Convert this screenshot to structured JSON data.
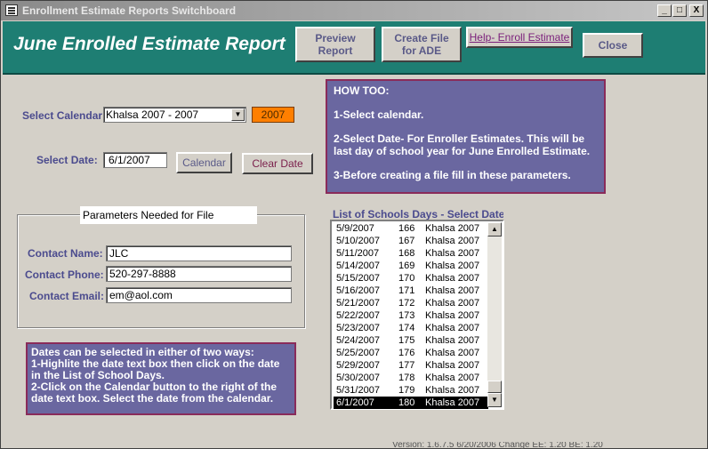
{
  "window": {
    "title": "Enrollment Estimate Reports Switchboard",
    "minimize": "_",
    "maximize": "□",
    "close": "X"
  },
  "header": {
    "title": "June Enrolled Estimate Report",
    "buttons": {
      "preview": "Preview Report",
      "create_file": "Create File for ADE",
      "help": "Help- Enroll Estimate",
      "close": "Close"
    }
  },
  "form": {
    "calendar_label": "Select Calendar:",
    "calendar_value": "Khalsa 2007 - 2007",
    "year_value": "2007",
    "date_label": "Select Date:",
    "date_value": "6/1/2007",
    "calendar_button": "Calendar",
    "clear_date_button": "Clear Date"
  },
  "howto": {
    "heading": "HOW TOO:",
    "step1": "1-Select calendar.",
    "step2": "2-Select Date- For  Enroller  Estimates.  This will be last day of school year for June Enrolled Estimate.",
    "step3": "3-Before creating a file fill in these parameters."
  },
  "parameters": {
    "caption": "Parameters Needed for File",
    "contact_name_label": "Contact Name:",
    "contact_name_value": "JLC",
    "contact_phone_label": "Contact Phone:",
    "contact_phone_value": "520-297-8888",
    "contact_email_label": "Contact Email:",
    "contact_email_value": "em@aol.com"
  },
  "dates_note": {
    "line1": "Dates can be selected in either of two ways:",
    "line2": "1-Highlite the date text box then click on the date in the List of School Days.",
    "line3": "2-Click on the Calendar button to the right of the date text box. Select the date from the calendar."
  },
  "school_days": {
    "caption": "List of Schools Days - Select Date",
    "rows": [
      {
        "date": "5/9/2007",
        "day": "166",
        "calendar": "Khalsa 2007",
        "selected": false
      },
      {
        "date": "5/10/2007",
        "day": "167",
        "calendar": "Khalsa 2007",
        "selected": false
      },
      {
        "date": "5/11/2007",
        "day": "168",
        "calendar": "Khalsa 2007",
        "selected": false
      },
      {
        "date": "5/14/2007",
        "day": "169",
        "calendar": "Khalsa 2007",
        "selected": false
      },
      {
        "date": "5/15/2007",
        "day": "170",
        "calendar": "Khalsa 2007",
        "selected": false
      },
      {
        "date": "5/16/2007",
        "day": "171",
        "calendar": "Khalsa 2007",
        "selected": false
      },
      {
        "date": "5/21/2007",
        "day": "172",
        "calendar": "Khalsa 2007",
        "selected": false
      },
      {
        "date": "5/22/2007",
        "day": "173",
        "calendar": "Khalsa 2007",
        "selected": false
      },
      {
        "date": "5/23/2007",
        "day": "174",
        "calendar": "Khalsa 2007",
        "selected": false
      },
      {
        "date": "5/24/2007",
        "day": "175",
        "calendar": "Khalsa 2007",
        "selected": false
      },
      {
        "date": "5/25/2007",
        "day": "176",
        "calendar": "Khalsa 2007",
        "selected": false
      },
      {
        "date": "5/29/2007",
        "day": "177",
        "calendar": "Khalsa 2007",
        "selected": false
      },
      {
        "date": "5/30/2007",
        "day": "178",
        "calendar": "Khalsa 2007",
        "selected": false
      },
      {
        "date": "5/31/2007",
        "day": "179",
        "calendar": "Khalsa 2007",
        "selected": false
      },
      {
        "date": "6/1/2007",
        "day": "180",
        "calendar": "Khalsa 2007",
        "selected": true
      }
    ]
  },
  "statusbar": {
    "text": "Version: 1.6.7.5 6/20/2006   Change EE: 1.20   BE: 1.20"
  },
  "colors": {
    "header_bg": "#1e7e73",
    "info_box_bg": "#6a67a0",
    "info_box_border": "#8a2b5a",
    "label_text": "#4b4b8e",
    "year_box": "#ff7f00"
  },
  "icons": [
    "app-icon",
    "combo-dropdown-icon",
    "scroll-up-icon",
    "scroll-down-icon"
  ]
}
